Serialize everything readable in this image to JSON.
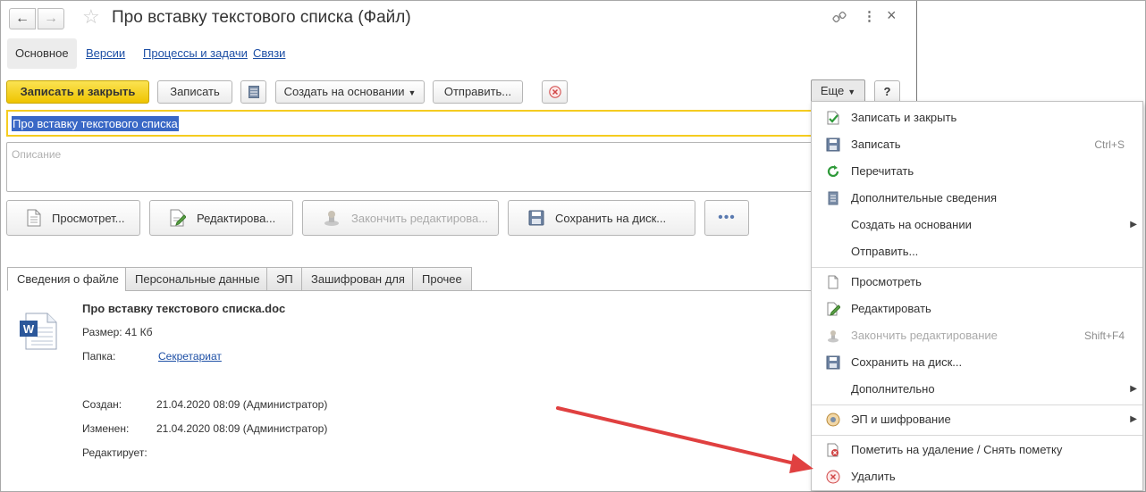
{
  "window": {
    "title": "Про вставку текстового списка (Файл)",
    "nav_back": "←",
    "nav_forward": "→",
    "star": "☆",
    "link_icon": "🔗",
    "menu_icon": "⋮",
    "close_icon": "×"
  },
  "sections": [
    "Основное",
    "Версии",
    "Процессы и задачи",
    "Связи"
  ],
  "toolbar": {
    "save_close": "Записать и закрыть",
    "save": "Записать",
    "create_based": "Создать на основании",
    "send": "Отправить...",
    "more": "Еще",
    "help": "?"
  },
  "name_field": {
    "value": "Про вставку текстового списка"
  },
  "description_field": {
    "placeholder": "Описание"
  },
  "file_buttons": {
    "view": "Просмотрет...",
    "edit": "Редактирова...",
    "finish_edit": "Закончить редактирова...",
    "save_to_disk": "Сохранить на диск...",
    "more": "•••"
  },
  "tabs": [
    "Сведения о файле",
    "Персональные данные",
    "ЭП",
    "Зашифрован для",
    "Прочее"
  ],
  "file_info": {
    "filename": "Про вставку текстового списка.doc",
    "size": "Размер: 41 Кб",
    "folder_label": "Папка:",
    "folder_value": "Секретариат",
    "created_label": "Создан:",
    "created_value": "21.04.2020 08:09 (Администратор)",
    "modified_label": "Изменен:",
    "modified_value": "21.04.2020 08:09 (Администратор)",
    "editing_label": "Редактирует:"
  },
  "menu": {
    "items": [
      {
        "label": "Записать и закрыть",
        "shortcut": "",
        "icon": "save-close-icon"
      },
      {
        "label": "Записать",
        "shortcut": "Ctrl+S",
        "icon": "floppy-icon"
      },
      {
        "label": "Перечитать",
        "shortcut": "",
        "icon": "refresh-icon"
      },
      {
        "label": "Дополнительные сведения",
        "shortcut": "",
        "icon": "list-icon"
      },
      {
        "label": "Создать на основании",
        "shortcut": "",
        "icon": ""
      },
      {
        "label": "Отправить...",
        "shortcut": "",
        "icon": ""
      },
      {
        "label": "Просмотреть",
        "shortcut": "",
        "icon": "document-icon"
      },
      {
        "label": "Редактировать",
        "shortcut": "",
        "icon": "edit-document-icon"
      },
      {
        "label": "Закончить редактирование",
        "shortcut": "Shift+F4",
        "icon": "stamp-icon"
      },
      {
        "label": "Сохранить на диск...",
        "shortcut": "",
        "icon": "save-disk-icon"
      },
      {
        "label": "Дополнительно",
        "shortcut": "",
        "icon": ""
      },
      {
        "label": "ЭП и шифрование",
        "shortcut": "",
        "icon": "signature-icon"
      },
      {
        "label": "Пометить на удаление / Снять пометку",
        "shortcut": "",
        "icon": "mark-delete-icon"
      },
      {
        "label": "Удалить",
        "shortcut": "",
        "icon": "delete-icon"
      }
    ],
    "submenu_arrow": "▶"
  },
  "colors": {
    "accent_yellow": "#f3cf1e",
    "link_blue": "#1d4fa5",
    "selection_blue": "#3a68c6",
    "arrow_red": "#e04040"
  }
}
